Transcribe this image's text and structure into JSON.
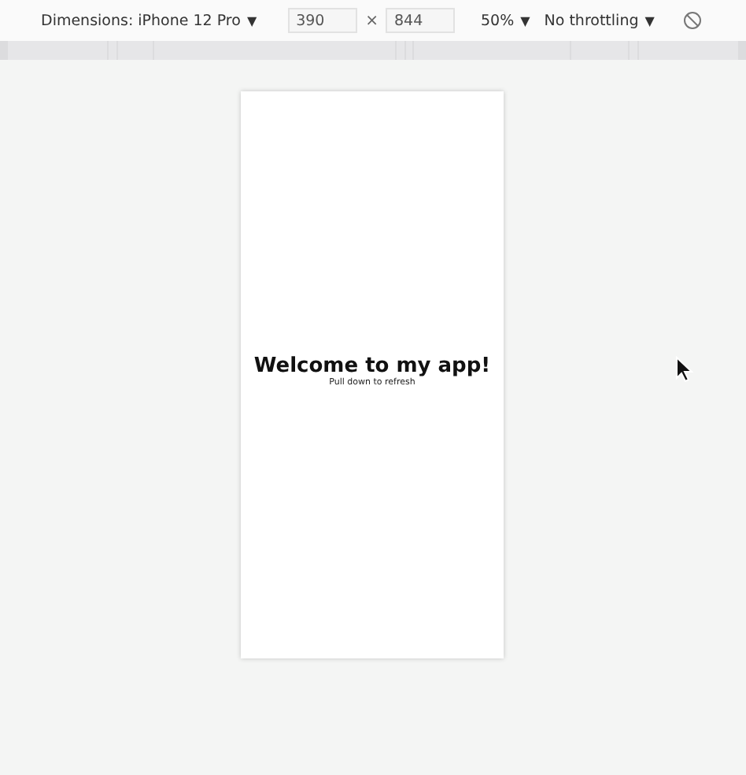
{
  "toolbar": {
    "device": {
      "label": "Dimensions: iPhone 12 Pro",
      "caret": "▼"
    },
    "width": {
      "value": "390"
    },
    "times": "×",
    "height": {
      "value": "844"
    },
    "zoom": {
      "label": "50%",
      "caret": "▼"
    },
    "throttling": {
      "label": "No throttling",
      "caret": "▼"
    }
  },
  "screen": {
    "title": "Welcome to my app!",
    "subtitle": "Pull down to refresh"
  }
}
